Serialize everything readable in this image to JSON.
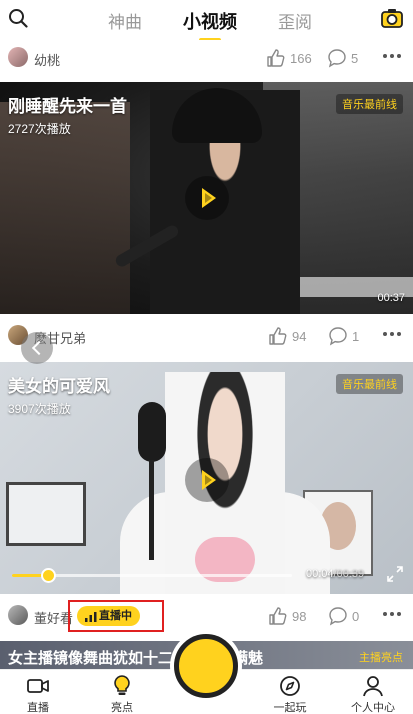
{
  "topnav": {
    "tabs": [
      "神曲",
      "小视频",
      "歪阅"
    ],
    "active_tab": "小视频"
  },
  "post1": {
    "user": "幼桃",
    "likes": "166",
    "comments": "5",
    "title": "刚睡醒先来一首",
    "plays": "2727次播放",
    "tag": "音乐最前线",
    "duration": "00:37"
  },
  "post2": {
    "user": "麽甘兄弟",
    "likes": "94",
    "comments": "1",
    "title": "美女的可爱风",
    "plays": "3907次播放",
    "tag": "音乐最前线",
    "current_time": "00:04",
    "total_time": "/00:39",
    "progress": 0.13
  },
  "post3": {
    "user": "董好看",
    "live_badge": "直播中",
    "likes": "98",
    "comments": "0"
  },
  "peek": {
    "title": "女主播镜像舞曲犹如十二月花，充满魅",
    "tag": "主播亮点"
  },
  "bottombar": {
    "items": [
      "直播",
      "亮点",
      "一起玩",
      "个人中心"
    ]
  },
  "colors": {
    "accent": "#ffd21e",
    "highlight_box": "#e02020"
  }
}
